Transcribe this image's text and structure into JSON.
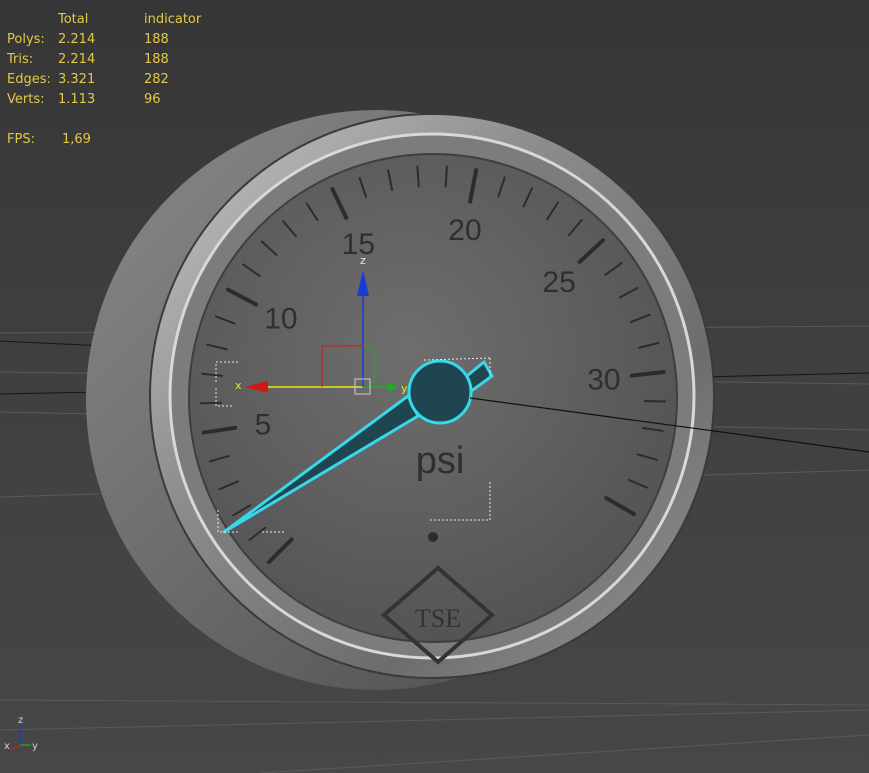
{
  "stats": {
    "headers": [
      "",
      "Total",
      "indicator"
    ],
    "rows": [
      {
        "label": "Polys:",
        "total": "2.214",
        "indicator": "188"
      },
      {
        "label": "Tris:",
        "total": "2.214",
        "indicator": "188"
      },
      {
        "label": "Edges:",
        "total": "3.321",
        "indicator": "282"
      },
      {
        "label": "Verts:",
        "total": "1.113",
        "indicator": "96"
      }
    ],
    "fps_label": "FPS:",
    "fps_value": "1,69"
  },
  "gauge": {
    "major_labels": [
      "5",
      "10",
      "15",
      "20",
      "25",
      "30"
    ],
    "unit": "psi",
    "brand": "TSE",
    "needle_value": 0
  },
  "gizmo": {
    "x_label": "x",
    "y_label": "y",
    "z_label": "z"
  },
  "axis_tripod": {
    "x_label": "x",
    "y_label": "y",
    "z_label": "z"
  },
  "colors": {
    "stats_text": "#e3c94a",
    "selection": "#37d8ea",
    "axis_x": "#d01818",
    "axis_y": "#1faa2a",
    "axis_z": "#1a3ad6",
    "gizmo_line": "#e8e81a"
  }
}
